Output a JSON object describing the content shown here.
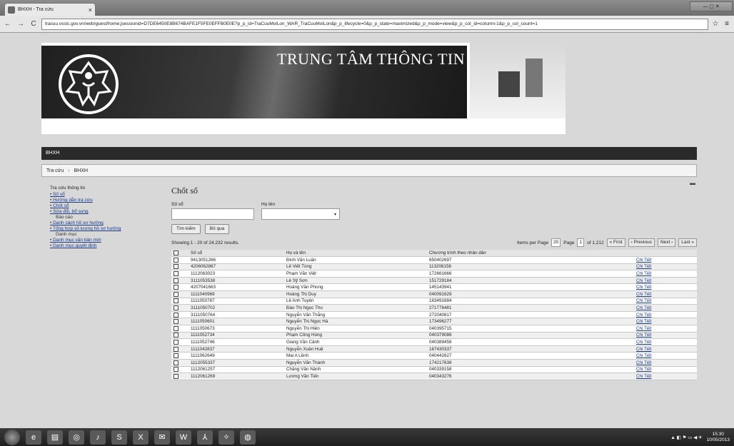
{
  "browser": {
    "tab_title": "BHXH - Tra cứu",
    "tab_close": "×",
    "url": "tracuu.vssic.gov.vn/web/guest/home;jsessionid=D7DE6450E8B674BAFE1F5FE0EFFB0E0E?p_p_id=TraCuuMoiLon_WAR_TraCuuMoiLon&p_p_lifecycle=0&p_p_state=maximized&p_p_mode=view&p_p_col_id=column-1&p_p_col_count=1"
  },
  "banner": {
    "title": "TRUNG TÂM THÔNG TIN",
    "logo_text": "BẢO HIỂM XÃ HỘI VIỆT NAM"
  },
  "topbar": {
    "label": "BHXH"
  },
  "breadcrumb": [
    "Tra cứu",
    "BHXH"
  ],
  "sidebar": {
    "title": "Tra cứu thông tin",
    "items": [
      {
        "label": "Số sổ",
        "type": "link"
      },
      {
        "label": "Hướng dẫn tra cứu",
        "type": "link"
      },
      {
        "label": "Chốt sổ",
        "type": "link"
      },
      {
        "label": "Sửa đổi, bổ sung",
        "type": "link"
      },
      {
        "label": "Báo cáo",
        "type": "group"
      },
      {
        "label": "Danh sách hồ sơ hưởng",
        "type": "link"
      },
      {
        "label": "Tổng hợp số lượng hồ sơ hưởng",
        "type": "link"
      },
      {
        "label": "Danh mục",
        "type": "group"
      },
      {
        "label": "Danh mục văn bản mới",
        "type": "link"
      },
      {
        "label": "Danh mục quyết định",
        "type": "link"
      }
    ]
  },
  "main": {
    "heading": "Chốt sổ",
    "so_so_label": "Số sổ",
    "ho_ten_label": "Họ tên",
    "search_button": "Tìm kiếm",
    "clear_button": "Bỏ qua",
    "results_text": "Showing 1 - 20 of 24.232 results.",
    "items_per_page_label": "Items per Page",
    "items_per_page_value": "20",
    "page_label": "Page",
    "page_value": "1",
    "page_of": "of 1.212",
    "first": "« First",
    "previous": "‹ Previous",
    "next": "Next ›",
    "last": "Last »",
    "columns": [
      "Số sổ",
      "Họ và tên",
      "Chương trình theo nhân dân",
      ""
    ],
    "rows": [
      [
        "9413051266",
        "Đinh Văn Luân",
        "650402697",
        "Chi Tiết"
      ],
      [
        "4206062867",
        "Lê Viết Tùng",
        "113208156",
        "Chi Tiết"
      ],
      [
        "1112063023",
        "Phạm Văn Việt",
        "172661666",
        "Chi Tiết"
      ],
      [
        "3111053538",
        "Lê Sỹ Sơn",
        "151729184",
        "Chi Tiết"
      ],
      [
        "4207041663",
        "Hoàng Văn Phong",
        "145143941",
        "Chi Tiết"
      ],
      [
        "1111040969",
        "Hoàng Thị Duy",
        "040091629",
        "Chi Tiết"
      ],
      [
        "1111050787",
        "Lê Anh Tuyên",
        "163491684",
        "Chi Tiết"
      ],
      [
        "3111050702",
        "Đào Thị Ngọc Thu",
        "271776481",
        "Chi Tiết"
      ],
      [
        "3111050764",
        "Nguyễn Văn Thắng",
        "272040817",
        "Chi Tiết"
      ],
      [
        "1111050601",
        "Nguyễn Thị Ngọc Hà",
        "173496277",
        "Chi Tiết"
      ],
      [
        "1111050673",
        "Nguyễn Thị Hiền",
        "040395715",
        "Chi Tiết"
      ],
      [
        "1111052734",
        "Phạm Công Hùng",
        "040379086",
        "Chi Tiết"
      ],
      [
        "1111052746",
        "Giang Văn Cảnh",
        "040389458",
        "Chi Tiết"
      ],
      [
        "1111042837",
        "Nguyễn Xuân Huệ",
        "187430337",
        "Chi Tiết"
      ],
      [
        "1111062649",
        "Mai A Lềnh",
        "040442627",
        "Chi Tiết"
      ],
      [
        "1112055337",
        "Nguyễn Văn Thành",
        "174217638",
        "Chi Tiết"
      ],
      [
        "1112061257",
        "Chăng Văn Nành",
        "040339158",
        "Chi Tiết"
      ],
      [
        "1112061269",
        "Lương Văn Tiến",
        "040343276",
        "Chi Tiết"
      ]
    ]
  },
  "taskbar": {
    "icons": [
      "start-icon",
      "ie-icon",
      "explorer-icon",
      "chrome-icon",
      "media-icon",
      "skype-icon",
      "excel-icon",
      "mail-icon",
      "word-icon",
      "pdf-icon",
      "network-icon",
      "globe-icon"
    ],
    "clock_time": "15:30",
    "clock_date": "10/05/2013"
  }
}
